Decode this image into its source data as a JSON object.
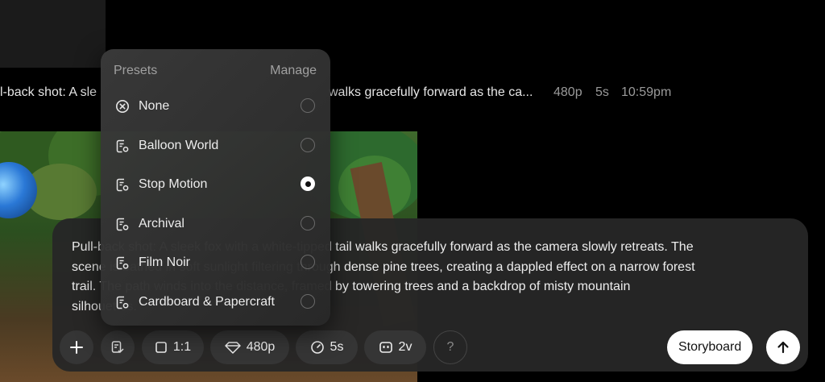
{
  "history": {
    "caption_left": "l-back shot: A sle",
    "caption_right": "walks gracefully forward as the ca...",
    "resolution": "480p",
    "duration": "5s",
    "time": "10:59pm"
  },
  "composer": {
    "prompt_lines": [
      "Pull-back shot: A sleek fox with a white-tipped tail walks gracefully forward as the camera slowly retreats. The",
      "scene is bathed in soft sunlight filtering through dense pine trees, creating a dappled effect on a narrow forest",
      "trail. The path winds into the distance, framed by towering trees and a backdrop of misty mountain",
      "silhouettes."
    ],
    "aspect_label": "1:1",
    "resolution_label": "480p",
    "duration_label": "5s",
    "variations_label": "2v",
    "help_label": "?",
    "storyboard_label": "Storyboard"
  },
  "presets_menu": {
    "title": "Presets",
    "manage_label": "Manage",
    "items": [
      {
        "label": "None",
        "icon": "circle-x-icon",
        "selected": false
      },
      {
        "label": "Balloon World",
        "icon": "preset-icon",
        "selected": false
      },
      {
        "label": "Stop Motion",
        "icon": "preset-icon",
        "selected": true
      },
      {
        "label": "Archival",
        "icon": "preset-icon",
        "selected": false
      },
      {
        "label": "Film Noir",
        "icon": "preset-icon",
        "selected": false
      },
      {
        "label": "Cardboard & Papercraft",
        "icon": "preset-icon",
        "selected": false
      }
    ]
  }
}
